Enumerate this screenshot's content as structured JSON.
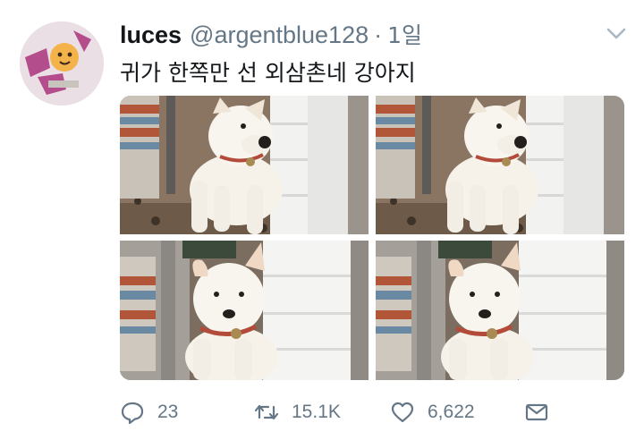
{
  "user": {
    "name": "luces",
    "handle": "@argentblue128",
    "separator": "·",
    "time": "1일"
  },
  "tweet": {
    "text": "귀가 한쪽만 선 외삼촌네 강아지"
  },
  "actions": {
    "reply_count": "23",
    "retweet_count": "15.1K",
    "like_count": "6,622"
  },
  "icons": {
    "caret": "chevron-down-icon",
    "reply": "reply-icon",
    "retweet": "retweet-icon",
    "like": "heart-icon",
    "dm": "envelope-icon"
  },
  "colors": {
    "text": "#14171a",
    "secondary": "#657786"
  }
}
